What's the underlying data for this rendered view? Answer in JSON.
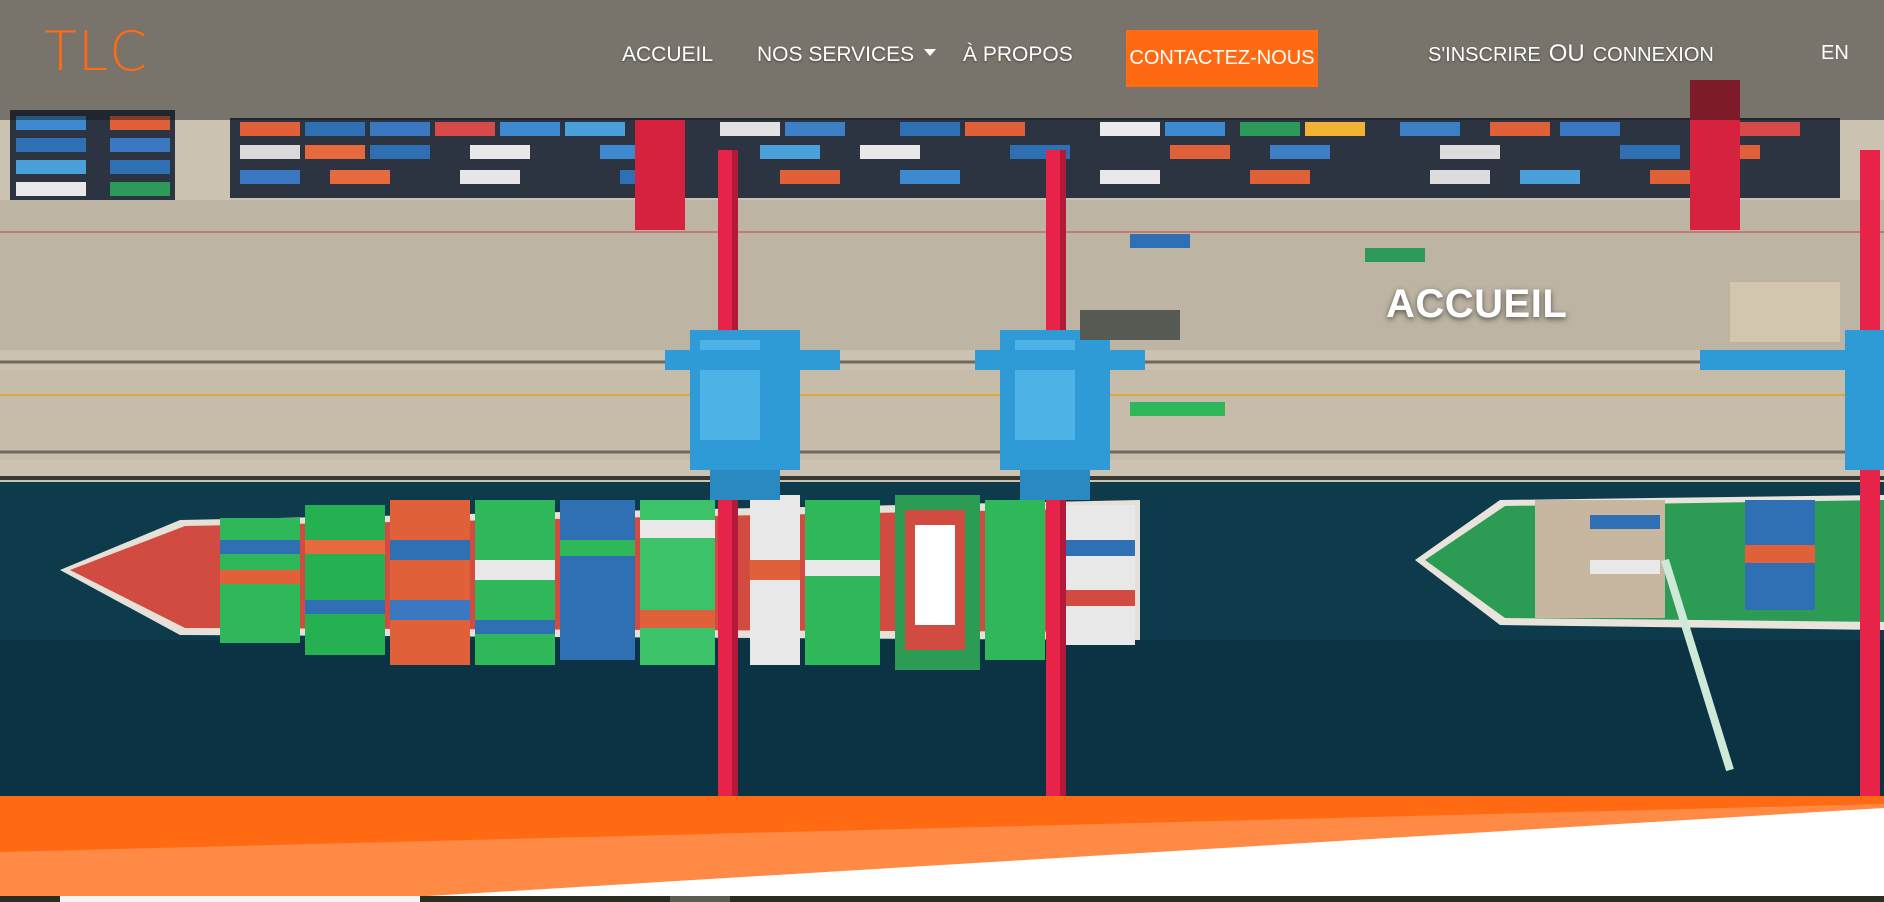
{
  "header": {
    "logo": "TLC",
    "nav": {
      "accueil": "ACCUEIL",
      "services": "NOS SERVICES",
      "apropos": "À PROPOS"
    },
    "contact_button": "CONTACTEZ-NOUS",
    "auth": {
      "signup": "S'INSCRIRE",
      "separator": "OU",
      "login": "CONNEXION"
    },
    "language": "EN"
  },
  "hero": {
    "title": "ACCUEIL"
  },
  "colors": {
    "accent": "#ff6a13",
    "accent_light": "#ff8a45",
    "water": "#0d3a4a",
    "dock": "#c9bfae",
    "crane_red": "#e8234a",
    "crane_blue": "#2f9bd6"
  },
  "icons": {
    "services_caret": "chevron-down-icon"
  }
}
